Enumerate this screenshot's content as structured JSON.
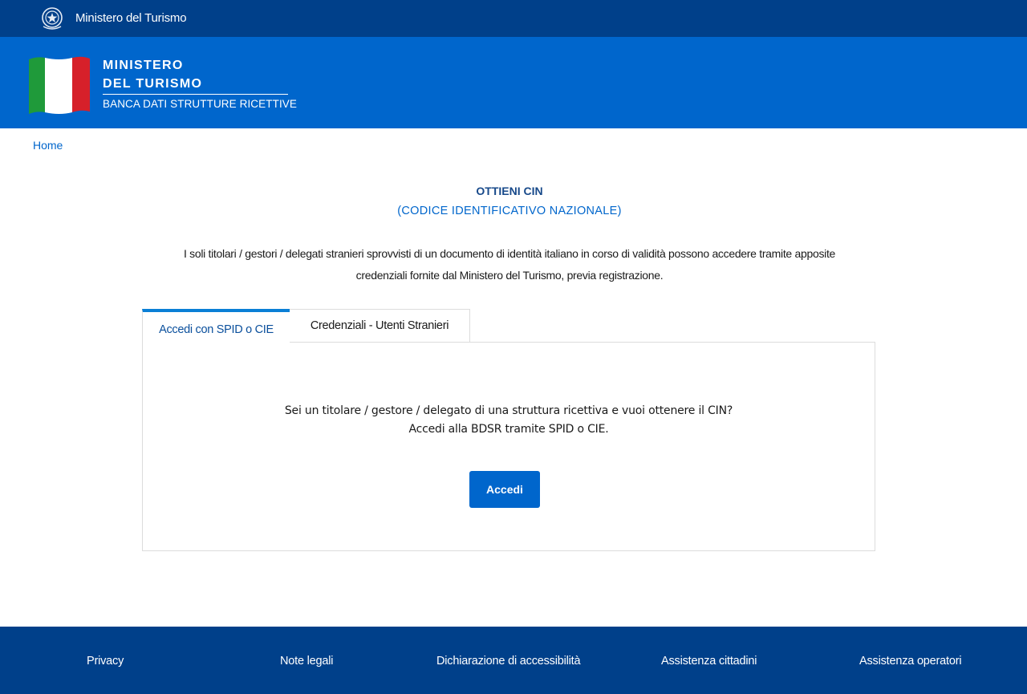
{
  "topbar": {
    "org_name": "Ministero del Turismo",
    "emblem_icon": "republic-emblem-icon"
  },
  "header": {
    "brand_line1": "MINISTERO",
    "brand_line2": "DEL TURISMO",
    "brand_sub": "BANCA DATI STRUTTURE RICETTIVE",
    "flag_icon": "italian-flag-icon"
  },
  "breadcrumb": {
    "home": "Home"
  },
  "main": {
    "title": "OTTIENI CIN",
    "subtitle": "(CODICE IDENTIFICATIVO NAZIONALE)",
    "intro_line1": "I soli titolari / gestori / delegati stranieri sprovvisti di un documento di identità italiano in corso di validità possono accedere tramite apposite",
    "intro_line2": "credenziali fornite dal Ministero del Turismo, previa registrazione.",
    "tabs": [
      {
        "label": "Accedi con SPID o CIE",
        "active": true
      },
      {
        "label": "Credenziali - Utenti Stranieri",
        "active": false
      }
    ],
    "panel": {
      "line1": "Sei un titolare / gestore / delegato di una struttura ricettiva e vuoi ottenere il CIN?",
      "line2": "Accedi alla BDSR tramite SPID o CIE.",
      "button_label": "Accedi"
    }
  },
  "footer": {
    "links": [
      "Privacy",
      "Note legali",
      "Dichiarazione di accessibilità",
      "Assistenza cittadini",
      "Assistenza operatori"
    ]
  },
  "colors": {
    "topbar": "#00408a",
    "header": "#0066cc",
    "primary": "#0066cc",
    "tab_accent": "#0a7fd6",
    "footer": "#00408a"
  }
}
